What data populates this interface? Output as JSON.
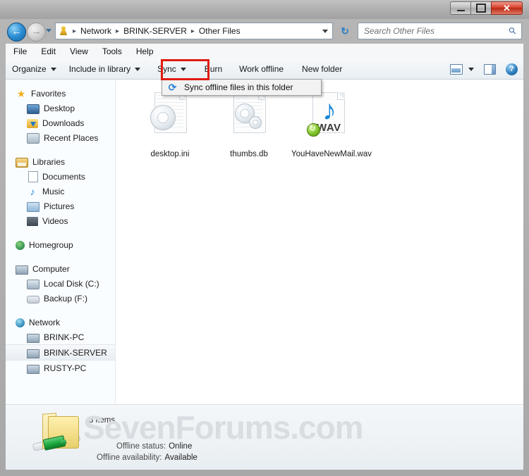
{
  "window": {
    "controls": {
      "minimize": "minimize-button",
      "maximize": "restore-button",
      "close": "✕"
    }
  },
  "address": {
    "back_glyph": "←",
    "forward_glyph": "→",
    "crumbs": [
      "Network",
      "BRINK-SERVER",
      "Other Files"
    ],
    "separator": "▸",
    "refresh_glyph": "↻"
  },
  "search": {
    "placeholder": "Search Other Files",
    "icon_glyph": "⚲"
  },
  "menubar": {
    "items": [
      "File",
      "Edit",
      "View",
      "Tools",
      "Help"
    ]
  },
  "toolbar": {
    "organize": "Organize",
    "include_in_library": "Include in library",
    "sync": "Sync",
    "burn": "Burn",
    "work_offline": "Work offline",
    "new_folder": "New folder",
    "help_glyph": "?"
  },
  "dropdown": {
    "icon_glyph": "⟳",
    "item_label": "Sync offline files in this folder"
  },
  "navpane": {
    "groups": [
      {
        "header": {
          "label": "Favorites",
          "icon": "star-icon"
        },
        "items": [
          {
            "label": "Desktop",
            "icon": "desktop-icon"
          },
          {
            "label": "Downloads",
            "icon": "downloads-icon"
          },
          {
            "label": "Recent Places",
            "icon": "recent-places-icon"
          }
        ]
      },
      {
        "header": {
          "label": "Libraries",
          "icon": "libraries-icon"
        },
        "items": [
          {
            "label": "Documents",
            "icon": "documents-icon"
          },
          {
            "label": "Music",
            "icon": "music-icon"
          },
          {
            "label": "Pictures",
            "icon": "pictures-icon"
          },
          {
            "label": "Videos",
            "icon": "videos-icon"
          }
        ]
      },
      {
        "header": {
          "label": "Homegroup",
          "icon": "homegroup-icon"
        },
        "items": []
      },
      {
        "header": {
          "label": "Computer",
          "icon": "computer-icon"
        },
        "items": [
          {
            "label": "Local Disk (C:)",
            "icon": "local-disk-icon"
          },
          {
            "label": "Backup (F:)",
            "icon": "backup-drive-icon"
          }
        ]
      },
      {
        "header": {
          "label": "Network",
          "icon": "network-icon"
        },
        "items": [
          {
            "label": "BRINK-PC",
            "icon": "computer-icon",
            "selected": false
          },
          {
            "label": "BRINK-SERVER",
            "icon": "computer-icon",
            "selected": true
          },
          {
            "label": "RUSTY-PC",
            "icon": "computer-icon",
            "selected": false
          }
        ]
      }
    ]
  },
  "content": {
    "files": [
      {
        "name": "desktop.ini",
        "icon": "ini-gear-file-icon"
      },
      {
        "name": "thumbs.db",
        "icon": "db-gears-file-icon"
      },
      {
        "name": "YouHaveNewMail.wav",
        "icon": "wav-audio-file-icon",
        "badge": "offline-available-badge",
        "type_text": "WAV"
      }
    ]
  },
  "statusbar": {
    "item_count": "3 items",
    "offline_status_label": "Offline status:",
    "offline_status_value": "Online",
    "offline_availability_label": "Offline availability:",
    "offline_availability_value": "Available",
    "folder_icon": "offline-folder-icon"
  },
  "watermark": {
    "text": "SevenForums.com"
  },
  "colors": {
    "accent_red": "#e01b10",
    "window_frame": "#b0b0b0",
    "content_bg": "#ffffff",
    "sync_blue": "#2f86d6",
    "badge_green": "#7fc32a"
  }
}
